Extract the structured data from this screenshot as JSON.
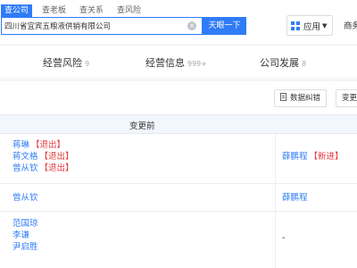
{
  "nav": {
    "tabs": [
      "查公司",
      "查老板",
      "查关系",
      "查风险"
    ],
    "search_value": "四川省宜宾五粮液供销有限公司",
    "search_button": "天眼一下",
    "apps_label": "应用",
    "business_link": "商务"
  },
  "categories": [
    {
      "label": "经营风险",
      "count": "9"
    },
    {
      "label": "经营信息",
      "count": "999+"
    },
    {
      "label": "公司发展",
      "count": "8"
    }
  ],
  "toolbar": {
    "correct_label": "数据纠错",
    "change_label": "变更"
  },
  "table": {
    "col_before": "变更前",
    "rows": [
      {
        "before": [
          {
            "name": "蒋琳",
            "tag": "【退出】"
          },
          {
            "name": "蒋文格",
            "tag": "【退出】"
          },
          {
            "name": "曾从钦",
            "tag": "【退出】"
          }
        ],
        "after": {
          "name": "薛鹏程",
          "tag": "【新进】"
        }
      },
      {
        "before": [
          {
            "name": "曾从钦",
            "tag": ""
          }
        ],
        "after": {
          "name": "薛鹏程",
          "tag": ""
        }
      },
      {
        "before": [
          {
            "name": "范国琼",
            "tag": ""
          },
          {
            "name": "李谦",
            "tag": ""
          },
          {
            "name": "尹启胜",
            "tag": ""
          }
        ],
        "after": {
          "name": "-",
          "tag": ""
        }
      }
    ]
  },
  "colors": {
    "accent": "#2f7cf6",
    "exit_tag": "#e5393b",
    "header_bg": "#f2f7fd"
  }
}
